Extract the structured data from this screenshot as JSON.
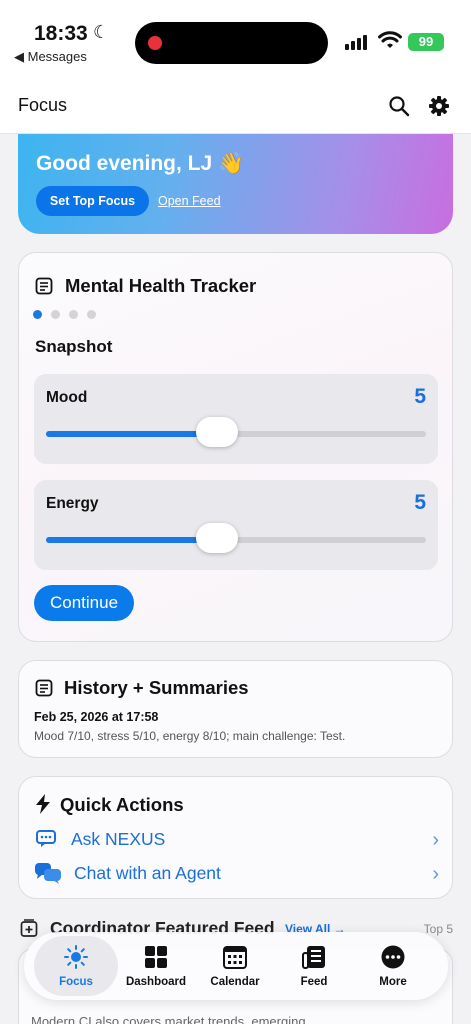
{
  "status_bar": {
    "time": "18:33",
    "back_label": "◀ Messages",
    "battery": "99"
  },
  "nav": {
    "title": "Focus"
  },
  "hero": {
    "greeting": "Good evening, LJ 👋",
    "primary_button": "Set Top Focus",
    "link": "Open Feed"
  },
  "mental_health": {
    "title": "Mental Health Tracker",
    "section": "Snapshot",
    "page_count": 4,
    "active_page": 1,
    "sliders": [
      {
        "label": "Mood",
        "value": "5",
        "level": 0.45
      },
      {
        "label": "Energy",
        "value": "5",
        "level": 0.45
      }
    ],
    "continue_label": "Continue"
  },
  "history": {
    "title": "History + Summaries",
    "date": "Feb 25, 2026 at 17:58",
    "text": "Mood 7/10, stress 5/10, energy 8/10; main challenge: Test."
  },
  "quick_actions": {
    "title": "Quick Actions",
    "items": [
      {
        "label": "Ask NEXUS"
      },
      {
        "label": "Chat with an Agent"
      }
    ]
  },
  "feed": {
    "title": "Coordinator Featured Feed",
    "view_all": "View All →",
    "top_label": "Top 5",
    "snippet": "Modern CI also covers market trends, emerging"
  },
  "tabs": [
    {
      "label": "Focus",
      "active": true
    },
    {
      "label": "Dashboard"
    },
    {
      "label": "Calendar"
    },
    {
      "label": "Feed"
    },
    {
      "label": "More"
    }
  ],
  "colors": {
    "accent": "#1a78e6",
    "hero_start": "#3db4f0",
    "hero_end": "#c86ee0",
    "battery": "#34c759"
  }
}
